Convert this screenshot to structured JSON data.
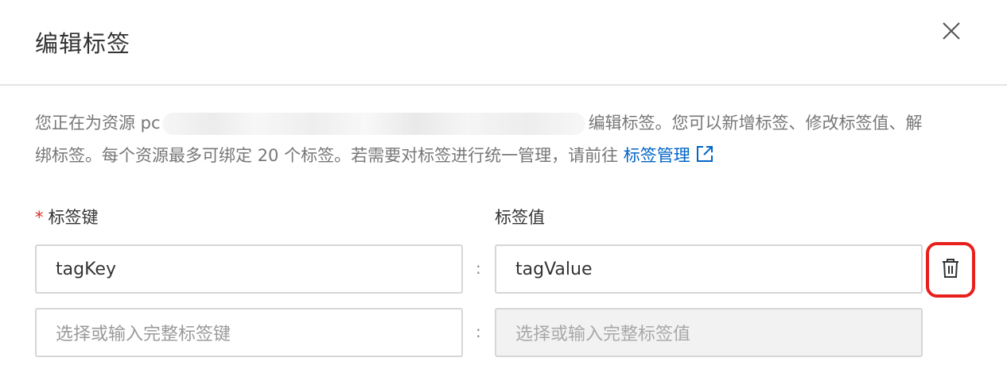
{
  "dialog": {
    "title": "编辑标签",
    "close_icon": "close-icon"
  },
  "description": {
    "prefix": "您正在为资源 pc",
    "after_resource": "编辑标签。您可以新增标签、修改标签值、解",
    "line2": "绑标签。每个资源最多可绑定 20 个标签。若需要对标签进行统一管理，请前往",
    "link_text": "标签管理",
    "link_icon": "external-link-icon",
    "link_color": "#0064c8"
  },
  "form": {
    "key_label": "标签键",
    "required_mark": "*",
    "value_label": "标签值",
    "separator": ":",
    "rows": [
      {
        "key": "tagKey",
        "value": "tagValue",
        "delete_icon": "trash-icon"
      },
      {
        "key_placeholder": "选择或输入完整标签键",
        "value_placeholder": "选择或输入完整标签值"
      }
    ]
  },
  "colors": {
    "highlight": "#e8201c",
    "required": "#d93026"
  }
}
